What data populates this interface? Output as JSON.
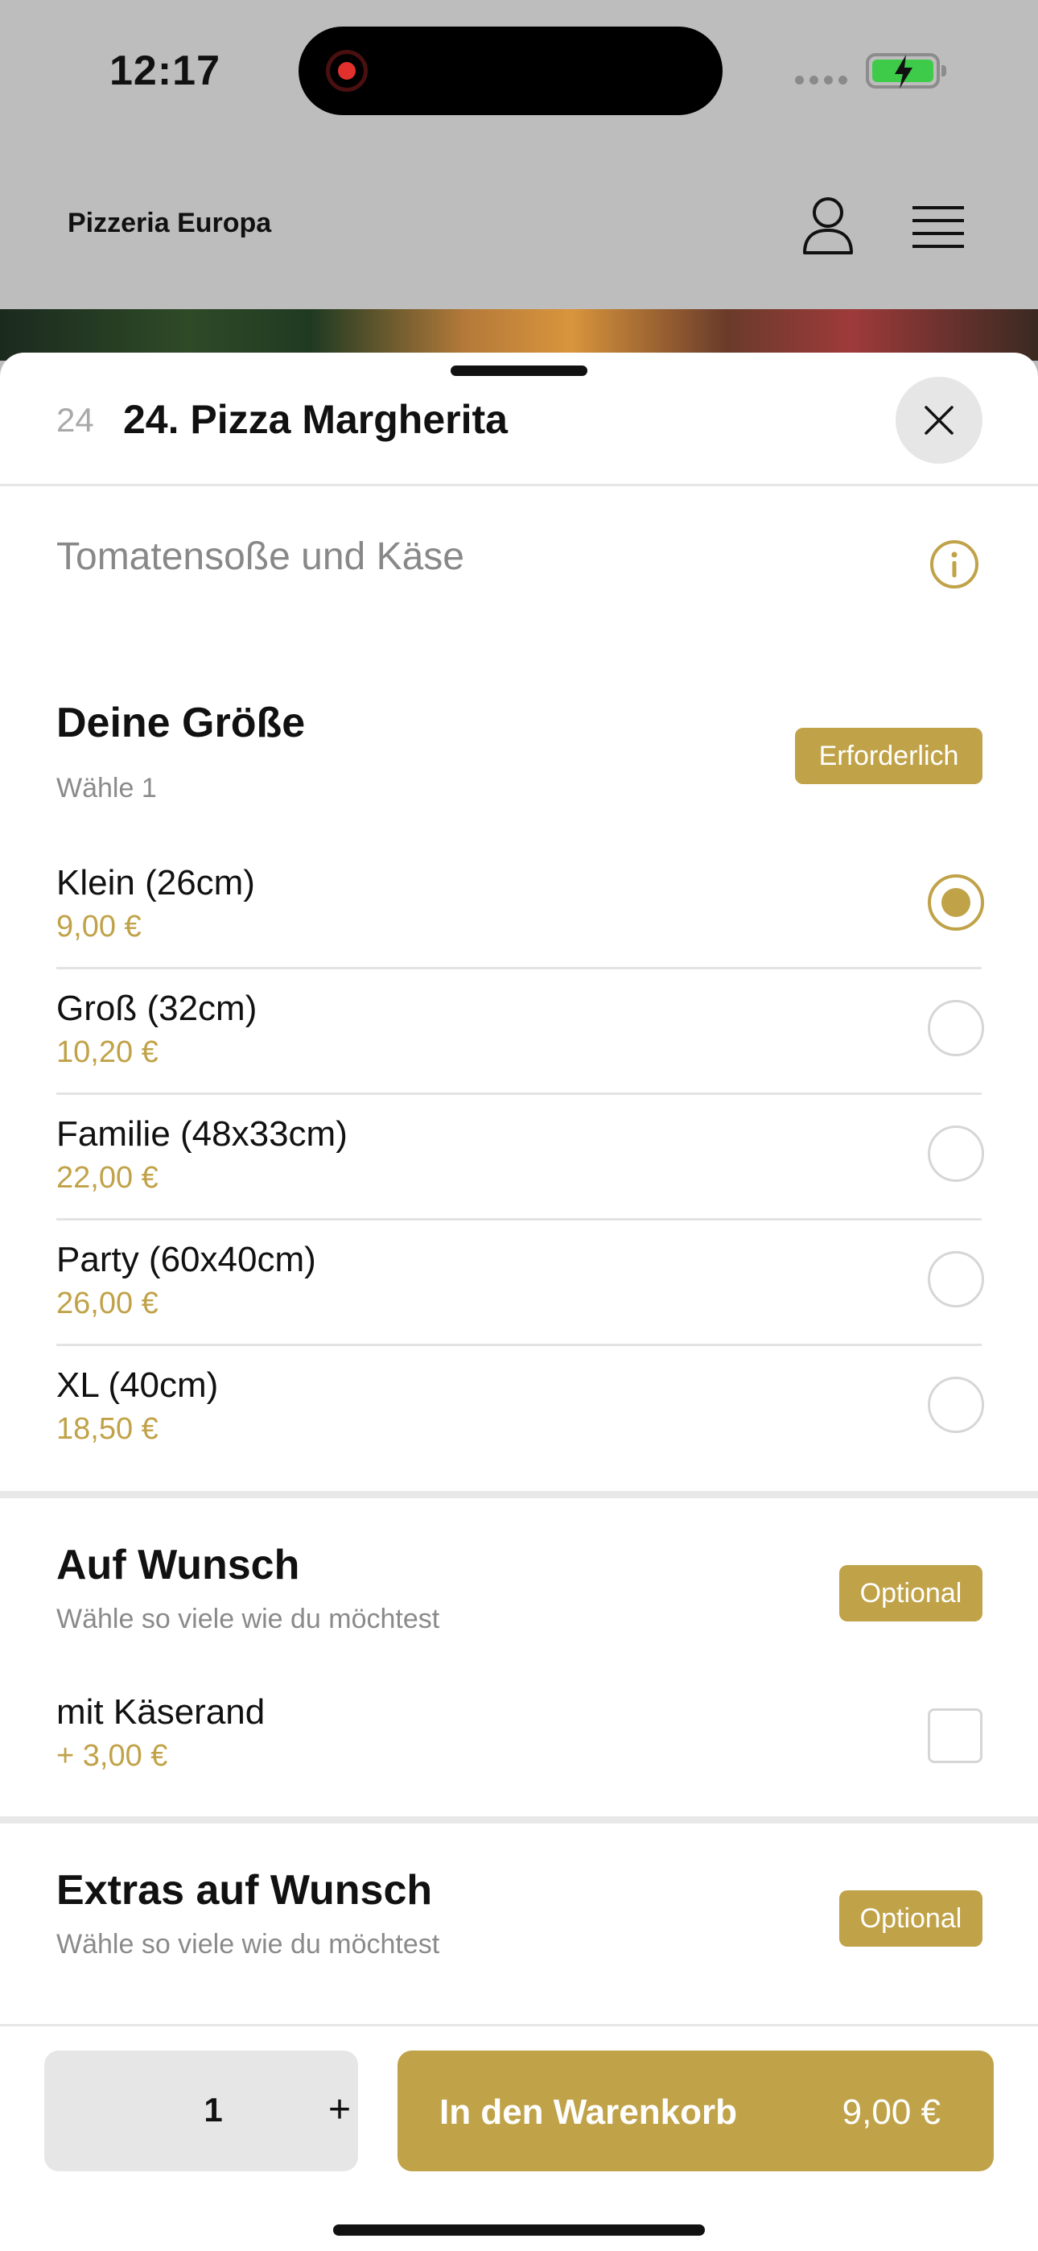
{
  "status_bar": {
    "time": "12:17"
  },
  "header": {
    "brand": "Pizzeria Europa"
  },
  "product": {
    "number": "24",
    "title": "24. Pizza Margherita",
    "description": "Tomatensoße und Käse"
  },
  "size_section": {
    "title": "Deine Größe",
    "subtitle": "Wähle 1",
    "badge": "Erforderlich",
    "selected_index": 0,
    "options": [
      {
        "label": "Klein (26cm)",
        "price": "9,00 €"
      },
      {
        "label": "Groß (32cm)",
        "price": "10,20 €"
      },
      {
        "label": "Familie (48x33cm)",
        "price": "22,00 €"
      },
      {
        "label": "Party (60x40cm)",
        "price": "26,00 €"
      },
      {
        "label": "XL (40cm)",
        "price": "18,50 €"
      }
    ]
  },
  "wish_section": {
    "title": "Auf Wunsch",
    "subtitle": "Wähle so viele wie du möchtest",
    "badge": "Optional",
    "options": [
      {
        "label": "mit Käserand",
        "price": "+ 3,00 €",
        "checked": false
      }
    ]
  },
  "extras_section": {
    "title": "Extras auf Wunsch",
    "subtitle": "Wähle so viele wie du möchtest",
    "badge": "Optional"
  },
  "bottom_bar": {
    "quantity": "1",
    "plus": "+",
    "cart_label": "In den Warenkorb",
    "cart_price": "9,00 €"
  },
  "colors": {
    "accent": "#c0a248",
    "overlay": "#bdbdbd"
  },
  "icons": [
    "record-icon",
    "signal-icon",
    "battery-icon",
    "user-icon",
    "hamburger-menu-icon",
    "close-icon",
    "info-icon"
  ]
}
